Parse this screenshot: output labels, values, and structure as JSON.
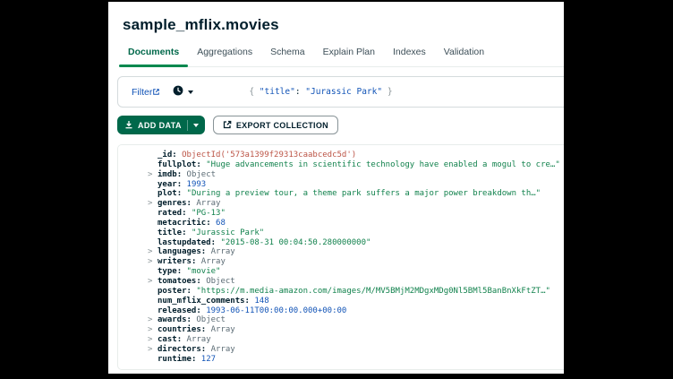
{
  "window": {
    "title": "sample_mflix.movies"
  },
  "tabs": [
    {
      "label": "Documents",
      "active": true
    },
    {
      "label": "Aggregations",
      "active": false
    },
    {
      "label": "Schema",
      "active": false
    },
    {
      "label": "Explain Plan",
      "active": false
    },
    {
      "label": "Indexes",
      "active": false
    },
    {
      "label": "Validation",
      "active": false
    }
  ],
  "filter_bar": {
    "filter_label": "Filter",
    "query": {
      "brace_open": "{ ",
      "key": "\"title\"",
      "colon": ": ",
      "value": "\"Jurassic Park\"",
      "brace_close": " }"
    }
  },
  "toolbar": {
    "add_data_label": "ADD DATA",
    "export_label": "EXPORT COLLECTION"
  },
  "document": {
    "caret_glyph": ">",
    "fields": [
      {
        "expandable": false,
        "key": "_id",
        "value": "ObjectId('573a1399f29313caabcedc5d')",
        "type": "objectid"
      },
      {
        "expandable": false,
        "key": "fullplot",
        "value": "\"Huge advancements in scientific technology have enabled a mogul to cre…\"",
        "type": "string"
      },
      {
        "expandable": true,
        "key": "imdb",
        "value": "Object",
        "type": "shell"
      },
      {
        "expandable": false,
        "key": "year",
        "value": "1993",
        "type": "number"
      },
      {
        "expandable": false,
        "key": "plot",
        "value": "\"During a preview tour, a theme park suffers a major power breakdown th…\"",
        "type": "string"
      },
      {
        "expandable": true,
        "key": "genres",
        "value": "Array",
        "type": "shell"
      },
      {
        "expandable": false,
        "key": "rated",
        "value": "\"PG-13\"",
        "type": "string"
      },
      {
        "expandable": false,
        "key": "metacritic",
        "value": "68",
        "type": "number"
      },
      {
        "expandable": false,
        "key": "title",
        "value": "\"Jurassic Park\"",
        "type": "string"
      },
      {
        "expandable": false,
        "key": "lastupdated",
        "value": "\"2015-08-31 00:04:50.280000000\"",
        "type": "string"
      },
      {
        "expandable": true,
        "key": "languages",
        "value": "Array",
        "type": "shell"
      },
      {
        "expandable": true,
        "key": "writers",
        "value": "Array",
        "type": "shell"
      },
      {
        "expandable": false,
        "key": "type",
        "value": "\"movie\"",
        "type": "string"
      },
      {
        "expandable": true,
        "key": "tomatoes",
        "value": "Object",
        "type": "shell"
      },
      {
        "expandable": false,
        "key": "poster",
        "value": "\"https://m.media-amazon.com/images/M/MV5BMjM2MDgxMDg0Nl5BMl5BanBnXkFtZT…\"",
        "type": "string"
      },
      {
        "expandable": false,
        "key": "num_mflix_comments",
        "value": "148",
        "type": "number"
      },
      {
        "expandable": false,
        "key": "released",
        "value": "1993-06-11T00:00:00.000+00:00",
        "type": "date"
      },
      {
        "expandable": true,
        "key": "awards",
        "value": "Object",
        "type": "shell"
      },
      {
        "expandable": true,
        "key": "countries",
        "value": "Array",
        "type": "shell"
      },
      {
        "expandable": true,
        "key": "cast",
        "value": "Array",
        "type": "shell"
      },
      {
        "expandable": true,
        "key": "directors",
        "value": "Array",
        "type": "shell"
      },
      {
        "expandable": false,
        "key": "runtime",
        "value": "127",
        "type": "number"
      }
    ]
  },
  "colors": {
    "brand_green_dark": "#00684A",
    "tab_underline_green": "#00884E",
    "link_blue": "#1254B7",
    "string_green": "#12824D",
    "number_blue": "#1254B7",
    "objectid_red": "#BC5446",
    "shell_gray": "#5C6C75",
    "border_gray": "#E8EDEB"
  }
}
